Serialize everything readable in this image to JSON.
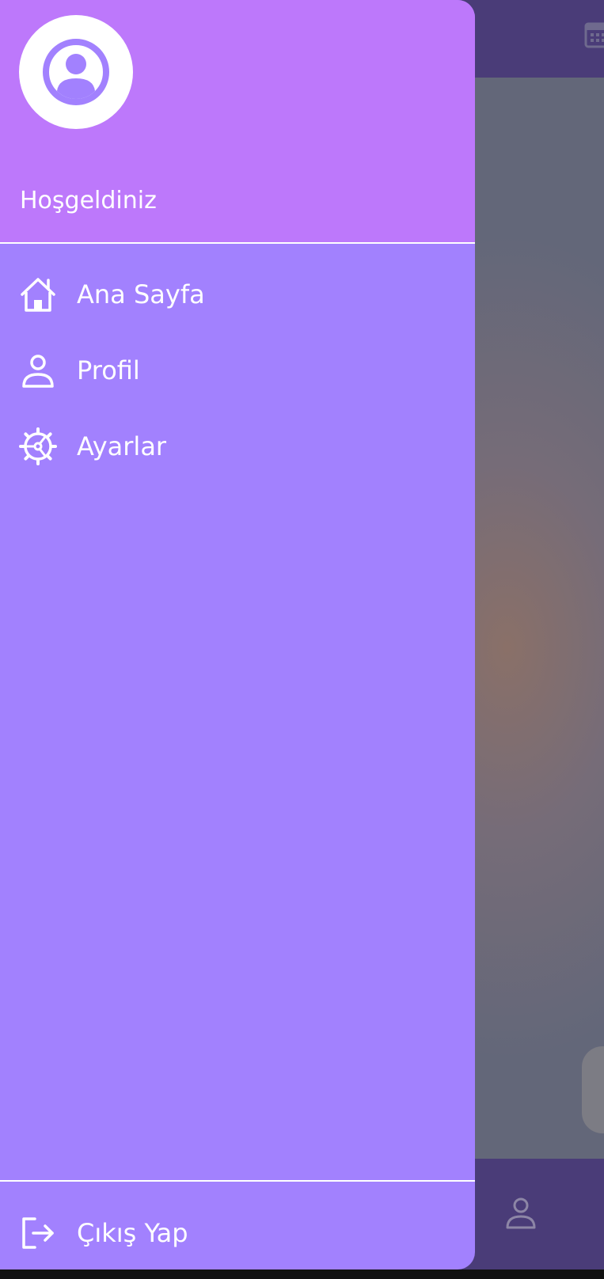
{
  "drawer": {
    "header": {
      "avatar_icon": "account-circle-icon",
      "welcome_text": "Hoşgeldiniz"
    },
    "items": [
      {
        "label": "Ana Sayfa",
        "icon": "home-icon"
      },
      {
        "label": "Profil",
        "icon": "person-icon"
      },
      {
        "label": "Ayarlar",
        "icon": "settings-icon"
      }
    ],
    "logout": {
      "label": "Çıkış Yap",
      "icon": "logout-icon"
    }
  },
  "colors": {
    "drawer_header": "#bd78fb",
    "drawer_body": "#a281fe",
    "app_bar": "#4a3c78",
    "text": "#ffffff"
  }
}
